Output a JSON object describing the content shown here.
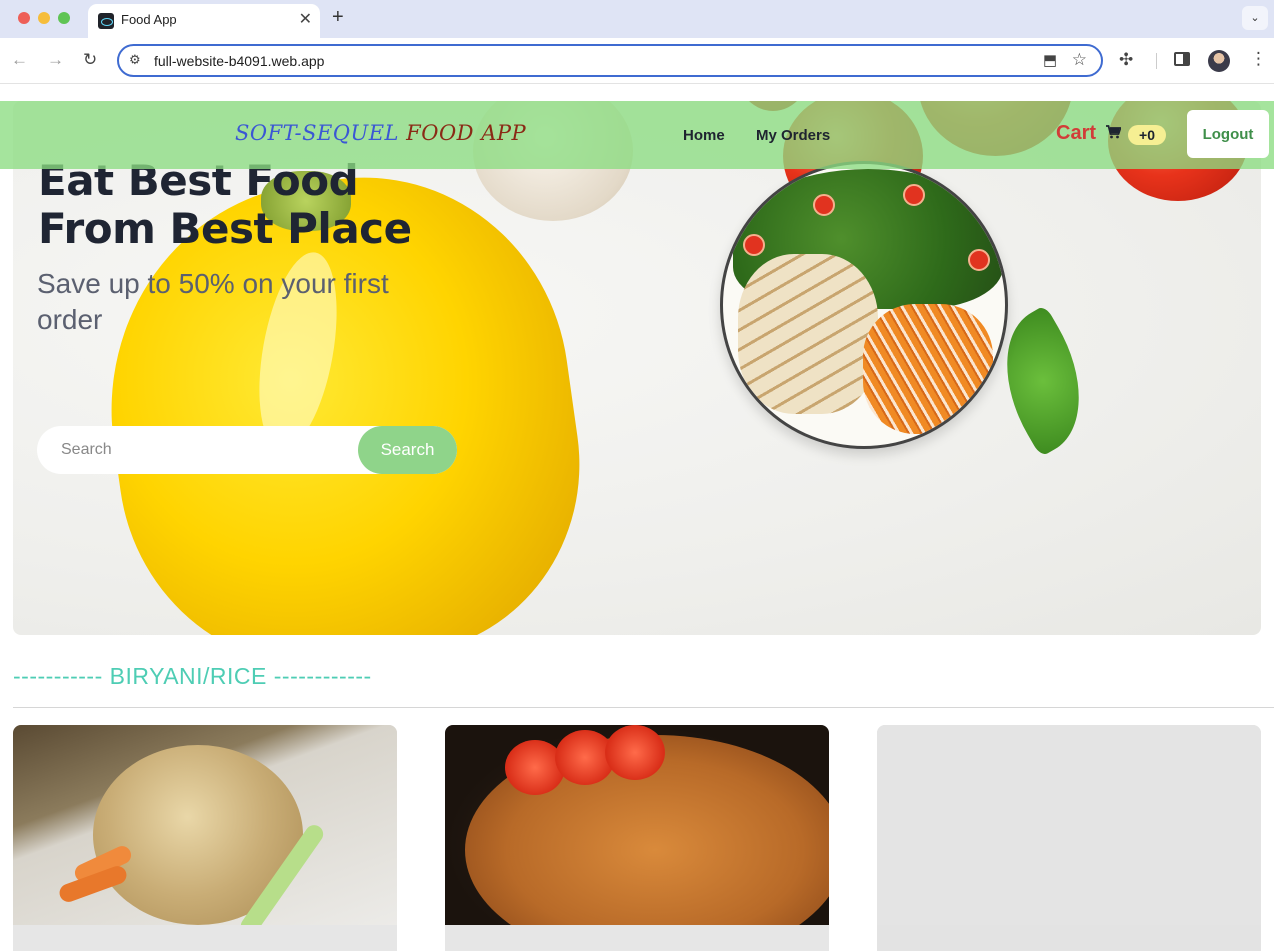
{
  "browser": {
    "tab_title": "Food App",
    "tab_close": "✕",
    "new_tab": "+",
    "tab_search": "⌄",
    "url": "full-website-b4091.web.app",
    "back": "←",
    "forward": "→",
    "reload": "↻",
    "menu": "⋮"
  },
  "navbar": {
    "brand_part1": "SOFT-SEQUEL",
    "brand_part2": "FOOD APP",
    "links": [
      "Home",
      "My Orders"
    ],
    "cart_label": "Cart",
    "cart_badge": "+0",
    "logout_label": "Logout"
  },
  "hero": {
    "title": "Eat Best Food From Best Place",
    "subtitle": "Save up to 50% on your first order",
    "search_placeholder": "Search",
    "search_button": "Search"
  },
  "category": {
    "label": "----------- BIRYANI/RICE ------------"
  },
  "colors": {
    "navbar_bg": "#8cdc82",
    "brand_part1": "#3b57d4",
    "brand_part2": "#8a2a16",
    "cart": "#d23c38",
    "badge": "#f6ef93",
    "search_button": "#8fd48a",
    "category": "#4ecdb4",
    "logout_text": "#3f8f4a"
  },
  "icons": {
    "cart": "shopping-cart-icon",
    "star": "star-icon",
    "extensions": "puzzle-icon"
  }
}
